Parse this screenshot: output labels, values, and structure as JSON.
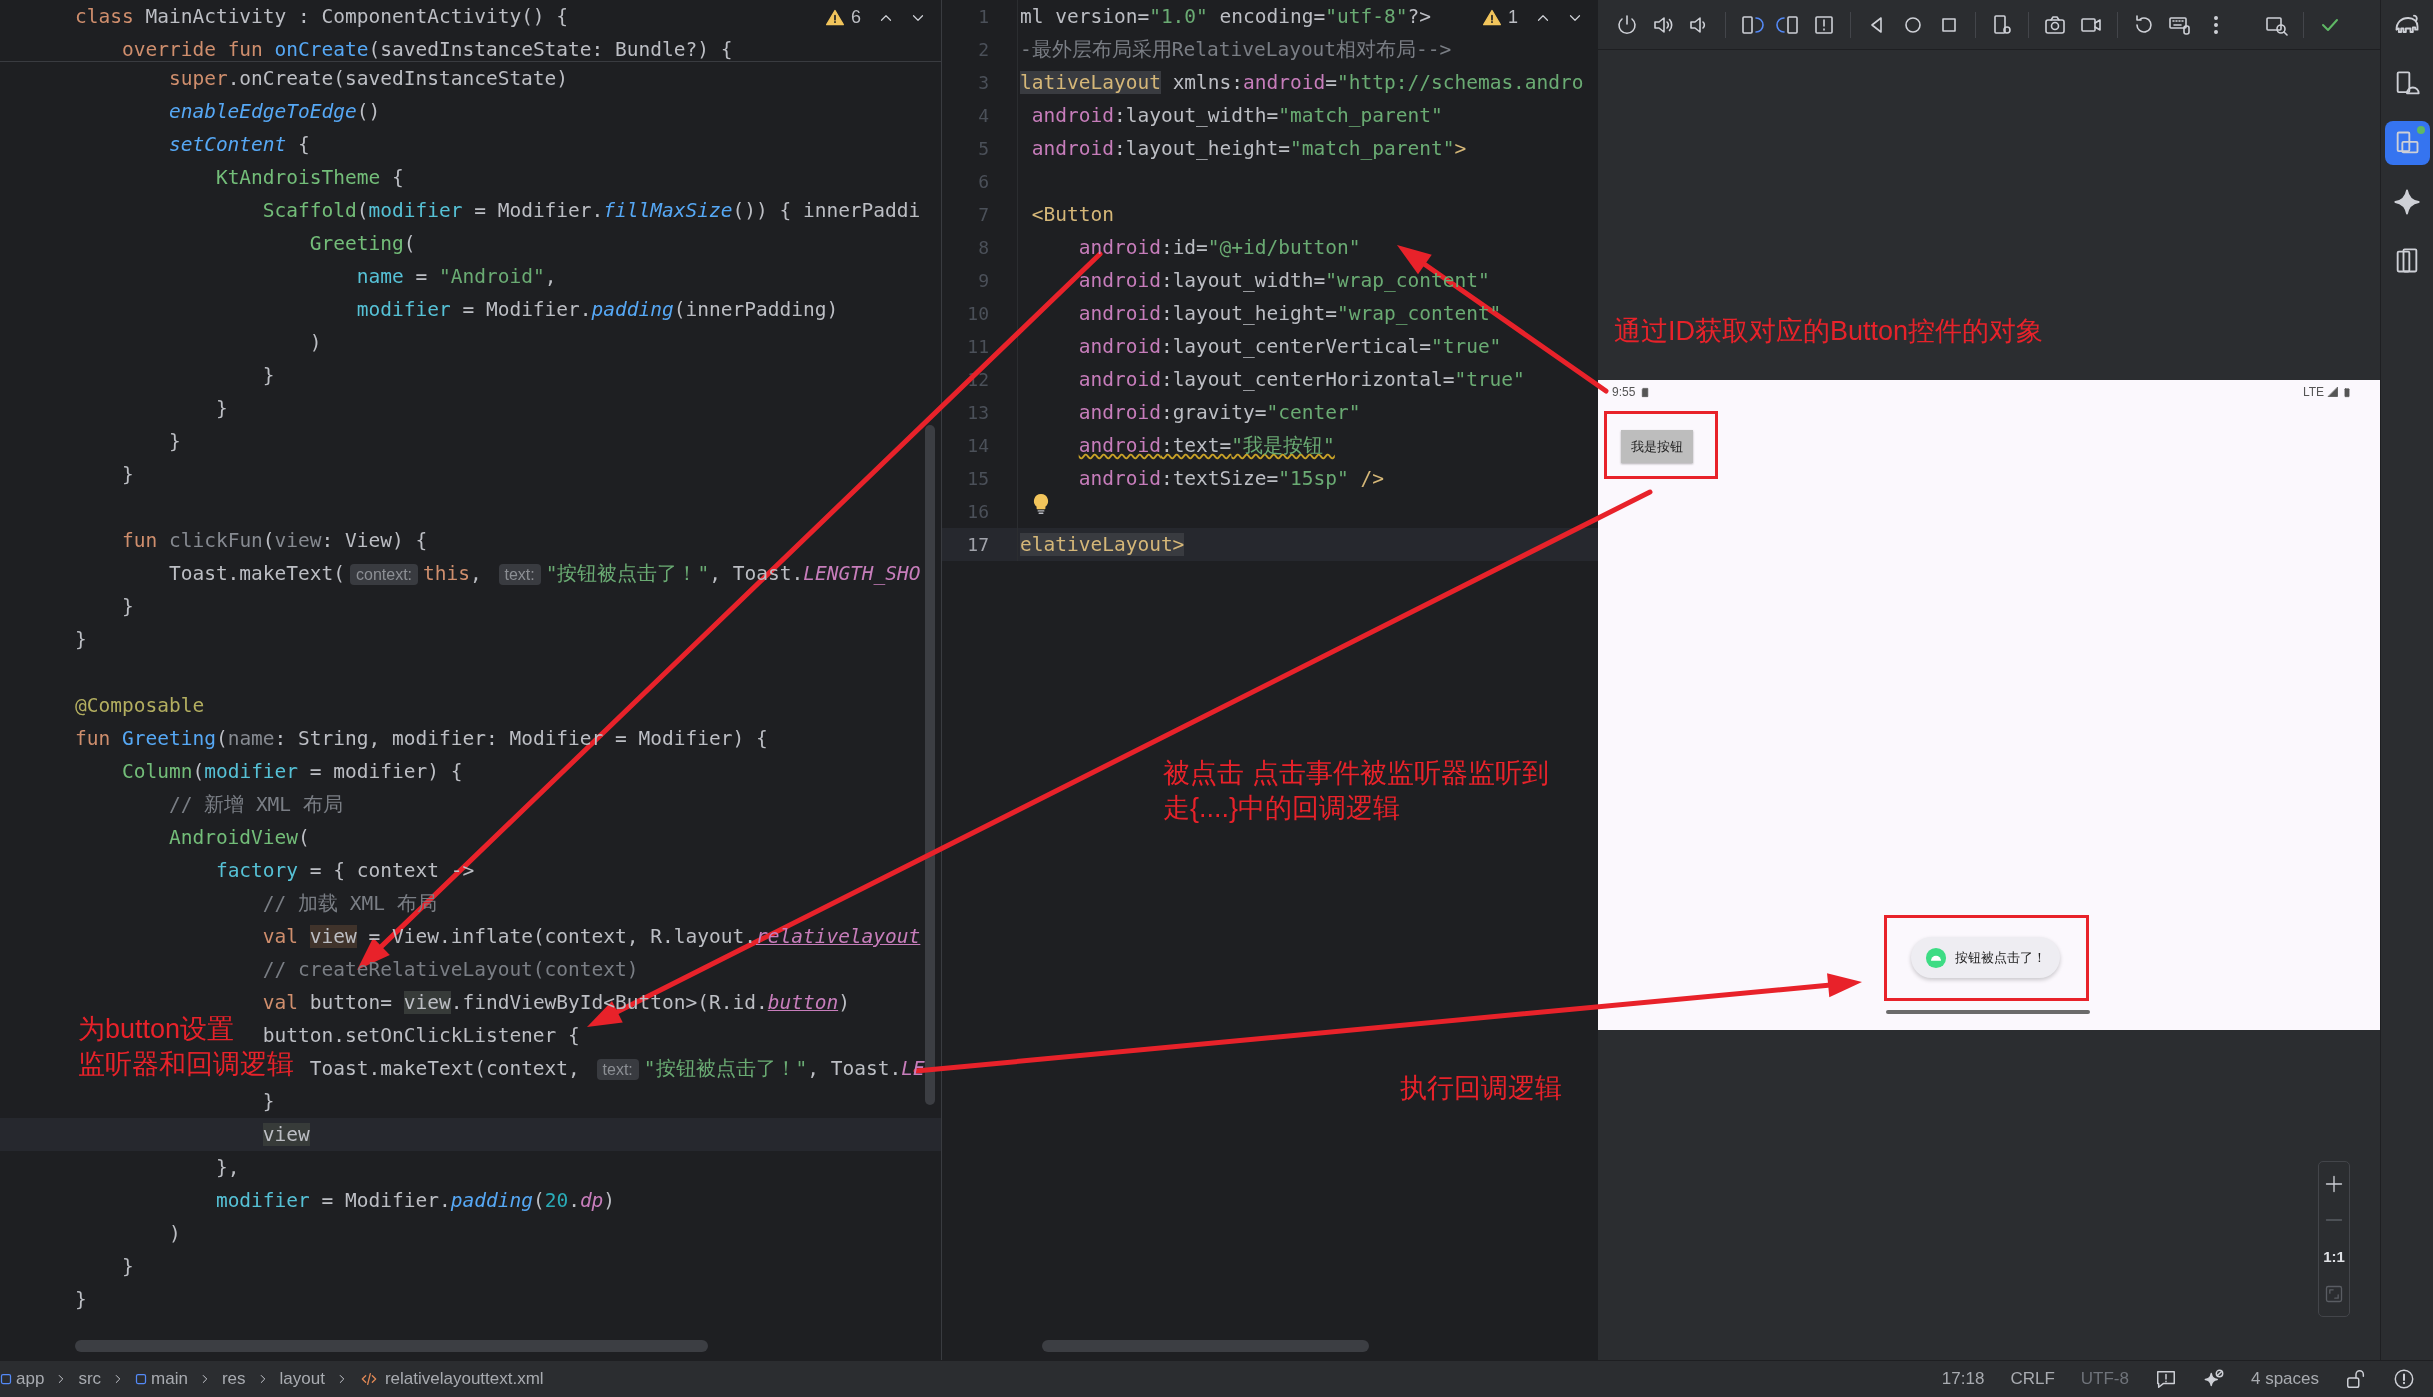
{
  "kotlin_editor": {
    "problems": {
      "count": "6"
    },
    "sticky_lines": [
      {
        "tokens": [
          {
            "text": "class ",
            "kind": "kw"
          },
          {
            "text": "MainActivity : ComponentActivity() {",
            "kind": "plain"
          }
        ]
      },
      {
        "tokens": [
          {
            "text": "    override fun ",
            "kind": "kw"
          },
          {
            "text": "onCreate",
            "kind": "fn"
          },
          {
            "text": "(savedInstanceState: Bundle?) {",
            "kind": "plain"
          }
        ]
      }
    ],
    "lines": [
      {
        "current": false,
        "tokens": [
          {
            "text": "        super",
            "kind": "kw"
          },
          {
            "text": ".onCreate(savedInstanceState)",
            "kind": "plain"
          }
        ]
      },
      {
        "current": false,
        "tokens": [
          {
            "text": "        enableEdgeToEdge",
            "kind": "fni"
          },
          {
            "text": "()",
            "kind": "plain"
          }
        ]
      },
      {
        "current": false,
        "tokens": [
          {
            "text": "        setContent",
            "kind": "fni"
          },
          {
            "text": " {",
            "kind": "plain"
          }
        ]
      },
      {
        "current": false,
        "tokens": [
          {
            "text": "            KtAndroisTheme",
            "kind": "comp"
          },
          {
            "text": " {",
            "kind": "plain"
          }
        ]
      },
      {
        "current": false,
        "tokens": [
          {
            "text": "                Scaffold",
            "kind": "comp"
          },
          {
            "text": "(",
            "kind": "plain"
          },
          {
            "text": "modifier",
            "kind": "arg"
          },
          {
            "text": " = Modifier.",
            "kind": "plain"
          },
          {
            "text": "fillMaxSize",
            "kind": "fni"
          },
          {
            "text": "()) { innerPaddi",
            "kind": "plain"
          }
        ]
      },
      {
        "current": false,
        "tokens": [
          {
            "text": "                    Greeting",
            "kind": "comp"
          },
          {
            "text": "(",
            "kind": "plain"
          }
        ]
      },
      {
        "current": false,
        "tokens": [
          {
            "text": "                        name",
            "kind": "arg"
          },
          {
            "text": " = ",
            "kind": "plain"
          },
          {
            "text": "\"Android\"",
            "kind": "str"
          },
          {
            "text": ",",
            "kind": "plain"
          }
        ]
      },
      {
        "current": false,
        "tokens": [
          {
            "text": "                        modifier",
            "kind": "arg"
          },
          {
            "text": " = Modifier.",
            "kind": "plain"
          },
          {
            "text": "padding",
            "kind": "fni"
          },
          {
            "text": "(innerPadding)",
            "kind": "plain"
          }
        ]
      },
      {
        "current": false,
        "tokens": [
          {
            "text": "                    )",
            "kind": "plain"
          }
        ]
      },
      {
        "current": false,
        "tokens": [
          {
            "text": "                }",
            "kind": "plain"
          }
        ]
      },
      {
        "current": false,
        "tokens": [
          {
            "text": "            }",
            "kind": "plain"
          }
        ]
      },
      {
        "current": false,
        "tokens": [
          {
            "text": "        }",
            "kind": "plain"
          }
        ]
      },
      {
        "current": false,
        "tokens": [
          {
            "text": "    }",
            "kind": "plain"
          }
        ]
      },
      {
        "current": false
      },
      {
        "current": false,
        "tokens": [
          {
            "text": "    fun ",
            "kind": "kw"
          },
          {
            "text": "clickFun",
            "kind": "dim"
          },
          {
            "text": "(",
            "kind": "plain"
          },
          {
            "text": "view",
            "kind": "dim"
          },
          {
            "text": ": View) {",
            "kind": "plain"
          }
        ]
      },
      {
        "current": false,
        "tokens": [
          {
            "text": "        Toast.makeText(",
            "kind": "plain"
          },
          {
            "text": "context:",
            "kind": "hint"
          },
          {
            "text": "this",
            "kind": "kw"
          },
          {
            "text": ", ",
            "kind": "plain"
          },
          {
            "text": "text:",
            "kind": "hint"
          },
          {
            "text": "\"按钮被点击了！\"",
            "kind": "str"
          },
          {
            "text": ", Toast.",
            "kind": "plain"
          },
          {
            "text": "LENGTH_SHO",
            "kind": "const"
          }
        ]
      },
      {
        "current": false,
        "tokens": [
          {
            "text": "    }",
            "kind": "plain"
          }
        ]
      },
      {
        "current": false,
        "tokens": [
          {
            "text": "}",
            "kind": "plain"
          }
        ]
      },
      {
        "current": false
      },
      {
        "current": false,
        "tokens": [
          {
            "text": "@Composable",
            "kind": "ann"
          }
        ]
      },
      {
        "current": false,
        "tokens": [
          {
            "text": "fun ",
            "kind": "kw"
          },
          {
            "text": "Greeting",
            "kind": "fn"
          },
          {
            "text": "(",
            "kind": "plain"
          },
          {
            "text": "name",
            "kind": "dim"
          },
          {
            "text": ": String, modifier: Modifier = Modifier) {",
            "kind": "plain"
          }
        ]
      },
      {
        "current": false,
        "tokens": [
          {
            "text": "    Column",
            "kind": "comp"
          },
          {
            "text": "(",
            "kind": "plain"
          },
          {
            "text": "modifier",
            "kind": "arg"
          },
          {
            "text": " = modifier) {",
            "kind": "plain"
          }
        ]
      },
      {
        "current": false,
        "tokens": [
          {
            "text": "        // 新增 XML 布局",
            "kind": "com"
          }
        ]
      },
      {
        "current": false,
        "tokens": [
          {
            "text": "        AndroidView",
            "kind": "comp"
          },
          {
            "text": "(",
            "kind": "plain"
          }
        ]
      },
      {
        "current": false,
        "tokens": [
          {
            "text": "            factory",
            "kind": "arg"
          },
          {
            "text": " = { context ->",
            "kind": "plain"
          }
        ]
      },
      {
        "current": false,
        "tokens": [
          {
            "text": "                // 加载 XML 布局",
            "kind": "com"
          }
        ]
      },
      {
        "current": false,
        "tokens": [
          {
            "text": "                val ",
            "kind": "kw"
          },
          {
            "text": "view",
            "kind": "hl-write"
          },
          {
            "text": " = View.inflate(context, R.layout.",
            "kind": "plain"
          },
          {
            "text": "relativelayout",
            "kind": "ref"
          }
        ]
      },
      {
        "current": false,
        "tokens": [
          {
            "text": "                // createRelativeLayout(context)",
            "kind": "com"
          }
        ]
      },
      {
        "current": false,
        "tokens": [
          {
            "text": "                val ",
            "kind": "kw"
          },
          {
            "text": "button= ",
            "kind": "plain"
          },
          {
            "text": "view",
            "kind": "hl-read"
          },
          {
            "text": ".findViewById<Button>(R.id.",
            "kind": "plain"
          },
          {
            "text": "button",
            "kind": "ref"
          },
          {
            "text": ")",
            "kind": "plain"
          }
        ]
      },
      {
        "current": false,
        "tokens": [
          {
            "text": "                button.setOnClickListener {",
            "kind": "plain"
          }
        ]
      },
      {
        "current": false,
        "tokens": [
          {
            "text": "                    Toast.makeText(context, ",
            "kind": "plain"
          },
          {
            "text": "text:",
            "kind": "hint"
          },
          {
            "text": "\"按钮被点击了！\"",
            "kind": "str"
          },
          {
            "text": ", Toast.",
            "kind": "plain"
          },
          {
            "text": "LE",
            "kind": "const"
          }
        ]
      },
      {
        "current": false,
        "tokens": [
          {
            "text": "                }",
            "kind": "plain"
          }
        ]
      },
      {
        "current": true,
        "tokens": [
          {
            "text": "                view",
            "kind": "hl-read"
          }
        ]
      },
      {
        "current": false,
        "tokens": [
          {
            "text": "            },",
            "kind": "plain"
          }
        ]
      },
      {
        "current": false,
        "tokens": [
          {
            "text": "            modifier",
            "kind": "arg"
          },
          {
            "text": " = Modifier.",
            "kind": "plain"
          },
          {
            "text": "padding",
            "kind": "fni"
          },
          {
            "text": "(",
            "kind": "plain"
          },
          {
            "text": "20",
            "kind": "num"
          },
          {
            "text": ".",
            "kind": "plain"
          },
          {
            "text": "dp",
            "kind": "const"
          },
          {
            "text": ")",
            "kind": "plain"
          }
        ]
      },
      {
        "current": false,
        "tokens": [
          {
            "text": "        )",
            "kind": "plain"
          }
        ]
      },
      {
        "current": false,
        "tokens": [
          {
            "text": "    }",
            "kind": "plain"
          }
        ]
      },
      {
        "current": false,
        "tokens": [
          {
            "text": "}",
            "kind": "plain"
          }
        ]
      }
    ]
  },
  "xml_editor": {
    "problems": {
      "count": "1"
    },
    "lines": [
      {
        "number": "1",
        "current": false,
        "tokens": [
          {
            "text": "ml version=",
            "kind": "plain"
          },
          {
            "text": "\"1.0\"",
            "kind": "str"
          },
          {
            "text": " encoding=",
            "kind": "plain"
          },
          {
            "text": "\"utf-8\"",
            "kind": "str"
          },
          {
            "text": "?>",
            "kind": "plain"
          }
        ]
      },
      {
        "number": "2",
        "current": false,
        "tokens": [
          {
            "text": "-最外层布局采用RelativeLayout相对布局-->",
            "kind": "com"
          }
        ]
      },
      {
        "number": "3",
        "current": false,
        "tokens": [
          {
            "text": "lativeLayout",
            "kind": "tag-hl"
          },
          {
            "text": " xmlns:",
            "kind": "plain"
          },
          {
            "text": "android",
            "kind": "ns"
          },
          {
            "text": "=",
            "kind": "plain"
          },
          {
            "text": "\"http://schemas.andro",
            "kind": "str"
          }
        ]
      },
      {
        "number": "4",
        "current": false,
        "tokens": [
          {
            "text": " android",
            "kind": "ns"
          },
          {
            "text": ":layout_width=",
            "kind": "plain"
          },
          {
            "text": "\"match_parent\"",
            "kind": "str"
          }
        ]
      },
      {
        "number": "5",
        "current": false,
        "tokens": [
          {
            "text": " android",
            "kind": "ns"
          },
          {
            "text": ":layout_height=",
            "kind": "plain"
          },
          {
            "text": "\"match_parent\"",
            "kind": "str"
          },
          {
            "text": ">",
            "kind": "tag"
          }
        ]
      },
      {
        "number": "6",
        "current": false
      },
      {
        "number": "7",
        "current": false,
        "tokens": [
          {
            "text": " <Button",
            "kind": "tag"
          }
        ]
      },
      {
        "number": "8",
        "current": false,
        "tokens": [
          {
            "text": "     android",
            "kind": "ns"
          },
          {
            "text": ":id=",
            "kind": "plain"
          },
          {
            "text": "\"@+id/button\"",
            "kind": "str"
          }
        ]
      },
      {
        "number": "9",
        "current": false,
        "tokens": [
          {
            "text": "     android",
            "kind": "ns"
          },
          {
            "text": ":layout_width=",
            "kind": "plain"
          },
          {
            "text": "\"wrap_content\"",
            "kind": "str"
          }
        ]
      },
      {
        "number": "10",
        "current": false,
        "tokens": [
          {
            "text": "     android",
            "kind": "ns"
          },
          {
            "text": ":layout_height=",
            "kind": "plain"
          },
          {
            "text": "\"wrap_content\"",
            "kind": "str"
          }
        ]
      },
      {
        "number": "11",
        "current": false,
        "tokens": [
          {
            "text": "     android",
            "kind": "ns"
          },
          {
            "text": ":layout_centerVertical=",
            "kind": "plain"
          },
          {
            "text": "\"true\"",
            "kind": "str"
          }
        ]
      },
      {
        "number": "12",
        "current": false,
        "tokens": [
          {
            "text": "     android",
            "kind": "ns"
          },
          {
            "text": ":layout_centerHorizontal=",
            "kind": "plain"
          },
          {
            "text": "\"true\"",
            "kind": "str"
          }
        ]
      },
      {
        "number": "13",
        "current": false,
        "tokens": [
          {
            "text": "     android",
            "kind": "ns"
          },
          {
            "text": ":gravity=",
            "kind": "plain"
          },
          {
            "text": "\"center\"",
            "kind": "str"
          }
        ]
      },
      {
        "number": "14",
        "current": false,
        "tokens": [
          {
            "text": "     android",
            "kind": "ns-warn"
          },
          {
            "text": ":text=",
            "kind": "plain-warn"
          },
          {
            "text": "\"我是按钮\"",
            "kind": "str-warn"
          }
        ]
      },
      {
        "number": "15",
        "current": false,
        "tokens": [
          {
            "text": "     android",
            "kind": "ns"
          },
          {
            "text": ":textSize=",
            "kind": "plain"
          },
          {
            "text": "\"15sp\"",
            "kind": "str"
          },
          {
            "text": " />",
            "kind": "tag"
          }
        ]
      },
      {
        "number": "16",
        "current": false
      },
      {
        "number": "17",
        "current": true,
        "tokens": [
          {
            "text": "elativeLayout>",
            "kind": "tag-hl"
          }
        ]
      }
    ]
  },
  "emulator": {
    "status_bar": {
      "time": "9:55",
      "network": "LTE"
    },
    "button": {
      "label": "我是按钮"
    },
    "toast": {
      "message": "按钮被点击了！"
    },
    "zoom_controls": {
      "actual_size": "1:1"
    }
  },
  "tool_windows": [
    {
      "kind": "gradle",
      "selected": false
    },
    {
      "kind": "device-manager",
      "selected": false
    },
    {
      "kind": "running-devices",
      "selected": true
    },
    {
      "kind": "gemini",
      "selected": false
    },
    {
      "kind": "device-mirroring",
      "selected": false
    }
  ],
  "annotations": [
    {
      "lines": [
        "通过ID获取对应的Button控件的对象"
      ]
    },
    {
      "lines": [
        "被点击 点击事件被监听器监听到",
        "走{....}中的回调逻辑"
      ]
    },
    {
      "lines": [
        "为button设置",
        "监听器和回调逻辑"
      ]
    },
    {
      "lines": [
        "执行回调逻辑"
      ]
    }
  ],
  "status_bar": {
    "breadcrumbs": [
      {
        "label": "app",
        "kind": "module"
      },
      {
        "label": "src",
        "kind": "folder"
      },
      {
        "label": "main",
        "kind": "module"
      },
      {
        "label": "res",
        "kind": "folder"
      },
      {
        "label": "layout",
        "kind": "folder"
      },
      {
        "label": "relativelayouttext.xml",
        "kind": "xml"
      }
    ],
    "caret": "17:18",
    "line_separator": "CRLF",
    "encoding": "UTF-8",
    "indent": "4 spaces"
  }
}
